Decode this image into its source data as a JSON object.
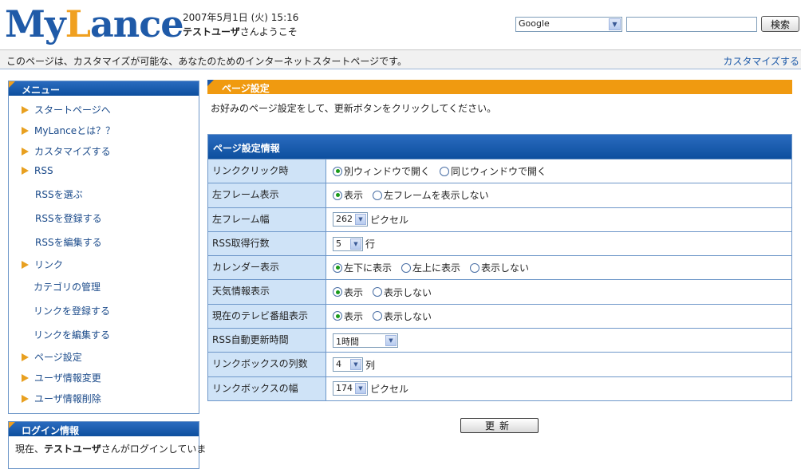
{
  "header": {
    "logo_part1": "My",
    "logo_part2": "L",
    "logo_part3": "ance",
    "date": "2007年5月1日 (火) 15:16",
    "user_name": "テストユーザ",
    "welcome_suffix": "さんようこそ",
    "search_engine": "Google",
    "search_value": "",
    "search_button": "検索"
  },
  "infobar": {
    "text": "このページは、カスタマイズが可能な、あなたのためのインターネットスタートページです。",
    "customize_link": "カスタマイズする"
  },
  "sidebar": {
    "menu_title": "メニュー",
    "items": [
      {
        "label": "スタートページへ",
        "top": 0
      },
      {
        "label": "MyLanceとは？？"
      },
      {
        "label": "カスタマイズする"
      },
      {
        "label": "RSS"
      },
      {
        "label": "RSSを選ぶ"
      },
      {
        "label": "RSSを登録する"
      },
      {
        "label": "RSSを編集する"
      },
      {
        "label": "リンク"
      },
      {
        "label": "カテゴリの管理"
      },
      {
        "label": "リンクを登録する"
      },
      {
        "label": "リンクを編集する"
      },
      {
        "label": "ページ設定"
      },
      {
        "label": "ユーザ情報変更"
      },
      {
        "label": "ユーザ情報削除"
      }
    ],
    "login_title": "ログイン情報",
    "login_prefix": "現在、",
    "login_user": "テストユーザ",
    "login_suffix": "さんがログインしていま"
  },
  "main": {
    "page_title": "ページ設定",
    "instruction": "お好みのページ設定をして、更新ボタンをクリックしてください。",
    "table_title": "ページ設定情報",
    "rows": {
      "link_click": {
        "label": "リンククリック時",
        "opt1": "別ウィンドウで開く",
        "opt2": "同じウィンドウで開く"
      },
      "left_frame": {
        "label": "左フレーム表示",
        "opt1": "表示",
        "opt2": "左フレームを表示しない"
      },
      "left_width": {
        "label": "左フレーム幅",
        "value": "262",
        "unit": "ピクセル"
      },
      "rss_rows": {
        "label": "RSS取得行数",
        "value": "5",
        "unit": "行"
      },
      "calendar": {
        "label": "カレンダー表示",
        "opt1": "左下に表示",
        "opt2": "左上に表示",
        "opt3": "表示しない"
      },
      "weather": {
        "label": "天気情報表示",
        "opt1": "表示",
        "opt2": "表示しない"
      },
      "tv": {
        "label": "現在のテレビ番組表示",
        "opt1": "表示",
        "opt2": "表示しない"
      },
      "rss_refresh": {
        "label": "RSS自動更新時間",
        "value": "1時間"
      },
      "link_cols": {
        "label": "リンクボックスの列数",
        "value": "4",
        "unit": "列"
      },
      "link_width": {
        "label": "リンクボックスの幅",
        "value": "174",
        "unit": "ピクセル"
      }
    },
    "update_button": "更新"
  },
  "colors": {
    "brand_blue": "#1f5aa8",
    "brand_orange": "#f0a020",
    "label_bg": "#cfe3f7"
  }
}
